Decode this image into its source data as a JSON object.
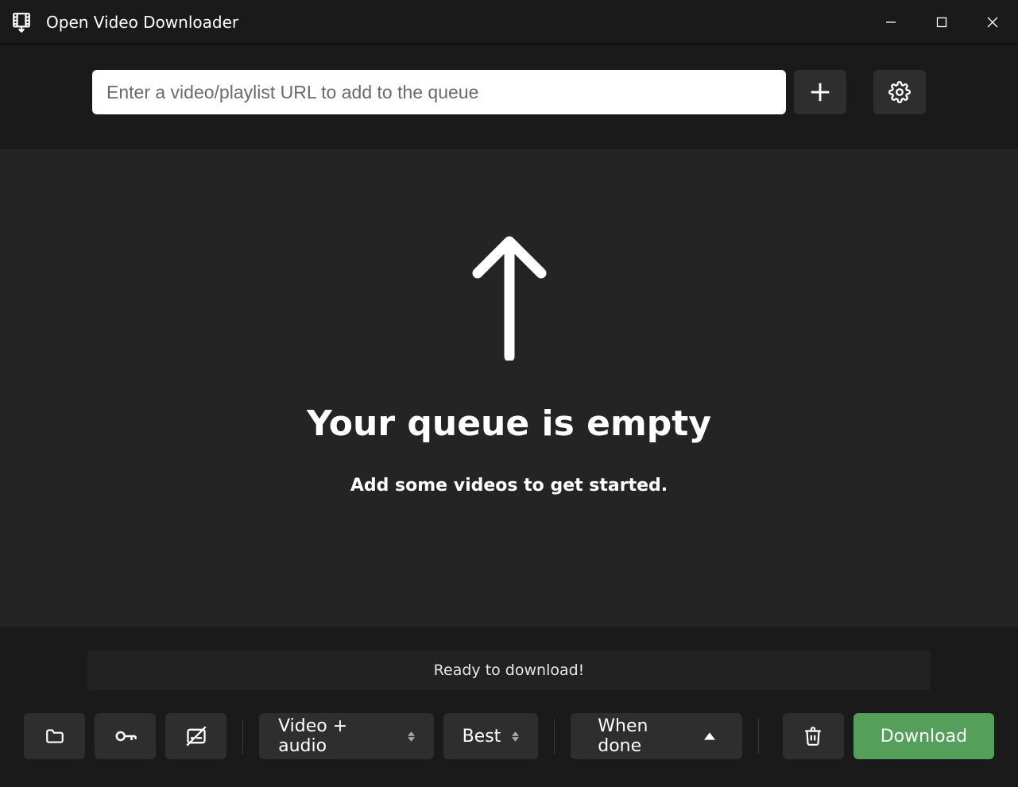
{
  "titlebar": {
    "app_title": "Open Video Downloader"
  },
  "inputbar": {
    "url_placeholder": "Enter a video/playlist URL to add to the queue",
    "url_value": ""
  },
  "main": {
    "empty_title": "Your queue is empty",
    "empty_subtitle": "Add some videos to get started."
  },
  "status": {
    "text": "Ready to download!"
  },
  "toolbar": {
    "format_label": "Video + audio",
    "quality_label": "Best",
    "when_done_label": "When done",
    "download_label": "Download"
  }
}
